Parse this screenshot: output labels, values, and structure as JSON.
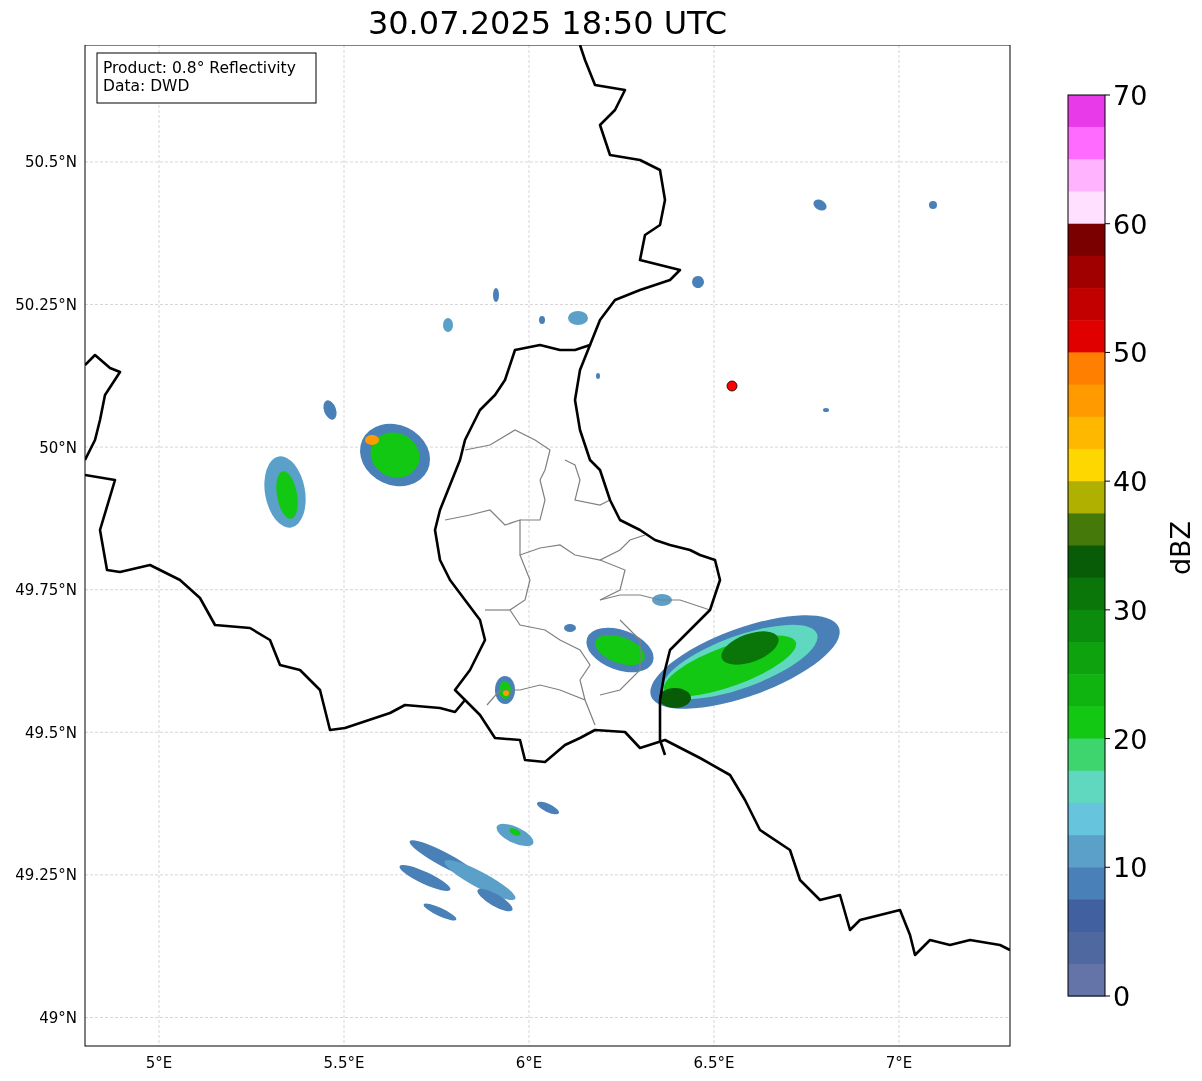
{
  "title": "30.07.2025 18:50 UTC",
  "legend": [
    "Product: 0.8° Reflectivity",
    "Data: DWD"
  ],
  "map": {
    "lat_ticks": [
      "50.5°N",
      "50.25°N",
      "50°N",
      "49.75°N",
      "49.5°N",
      "49.25°N",
      "49°N"
    ],
    "lon_ticks": [
      "5°E",
      "5.5°E",
      "6°E",
      "6.5°E",
      "7°E"
    ]
  },
  "colorbar": {
    "label": "dBZ",
    "ticks": [
      "70",
      "60",
      "50",
      "40",
      "30",
      "20",
      "10",
      "0"
    ],
    "bins": [
      {
        "color": "#e93ae9"
      },
      {
        "color": "#ff6bff"
      },
      {
        "color": "#ffb3ff"
      },
      {
        "color": "#ffe0ff"
      },
      {
        "color": "#7a0000"
      },
      {
        "color": "#a00000"
      },
      {
        "color": "#c20000"
      },
      {
        "color": "#e00000"
      },
      {
        "color": "#ff7f00"
      },
      {
        "color": "#ff9a00"
      },
      {
        "color": "#ffb800"
      },
      {
        "color": "#ffd700"
      },
      {
        "color": "#b0b000"
      },
      {
        "color": "#457a0a"
      },
      {
        "color": "#085c08"
      },
      {
        "color": "#0a760a"
      },
      {
        "color": "#0c8c0c"
      },
      {
        "color": "#0ea20e"
      },
      {
        "color": "#10b410"
      },
      {
        "color": "#12c812"
      },
      {
        "color": "#3ed46e"
      },
      {
        "color": "#60d8c0"
      },
      {
        "color": "#66c4dc"
      },
      {
        "color": "#5aa0c8"
      },
      {
        "color": "#4a80b8"
      },
      {
        "color": "#4060a0"
      },
      {
        "color": "#5068a0"
      },
      {
        "color": "#6474a8"
      }
    ]
  }
}
